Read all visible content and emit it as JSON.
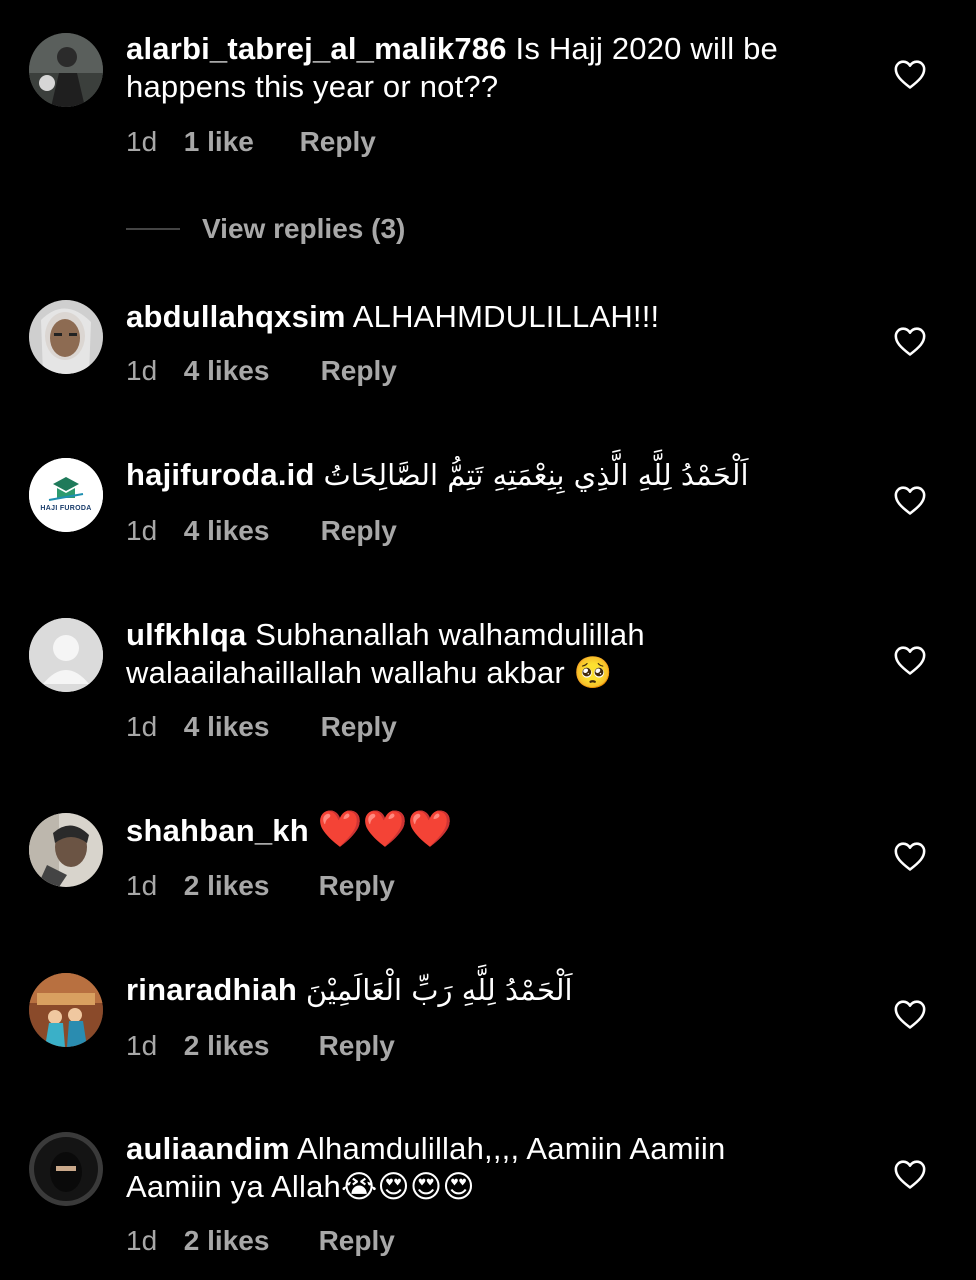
{
  "comments": [
    {
      "user": "alarbi_tabrej_al_malik786",
      "line1": " Is Hajj 2020 will be",
      "line2": "happens this year or not??",
      "time": "1d",
      "likes": "1 like",
      "reply": "Reply"
    },
    {
      "user": "abdullahqxsim",
      "line1": " ALHAHMDULILLAH!!!",
      "time": "1d",
      "likes": "4 likes",
      "reply": "Reply"
    },
    {
      "user": "hajifuroda.id",
      "line1": "اَلْحَمْدُ لِلَّهِ الَّذِي بِنِعْمَتِهِ تَتِمُّ الصَّالِحَاتُ",
      "time": "1d",
      "likes": "4 likes",
      "reply": "Reply",
      "avatar_text": "HAJI FURODA"
    },
    {
      "user": "ulfkhlqa",
      "line1": " Subhanallah walhamdulillah",
      "line2": "walaailahaillallah wallahu akbar",
      "emoji": "🥺",
      "time": "1d",
      "likes": "4 likes",
      "reply": "Reply"
    },
    {
      "user": "shahban_kh",
      "emoji": "❤️❤️❤️",
      "time": "1d",
      "likes": "2 likes",
      "reply": "Reply"
    },
    {
      "user": "rinaradhiah",
      "line1": "اَلْحَمْدُ لِلَّهِ رَبِّ الْعَالَمِيْنَ",
      "time": "1d",
      "likes": "2 likes",
      "reply": "Reply"
    },
    {
      "user": "auliaandim",
      "line1": " Alhamdulillah,,,, Aamiin Aamiin",
      "line2": "Aamiin ya Allah",
      "emoji": "😭😍😍😍",
      "time": "1d",
      "likes": "2 likes",
      "reply": "Reply"
    }
  ],
  "view_replies": "View replies (3)",
  "colors": {
    "background": "#000000",
    "text": "#ffffff",
    "secondary": "#a8a8a8",
    "divider": "#444444"
  },
  "icons": {
    "like": "heart-outline-icon"
  }
}
